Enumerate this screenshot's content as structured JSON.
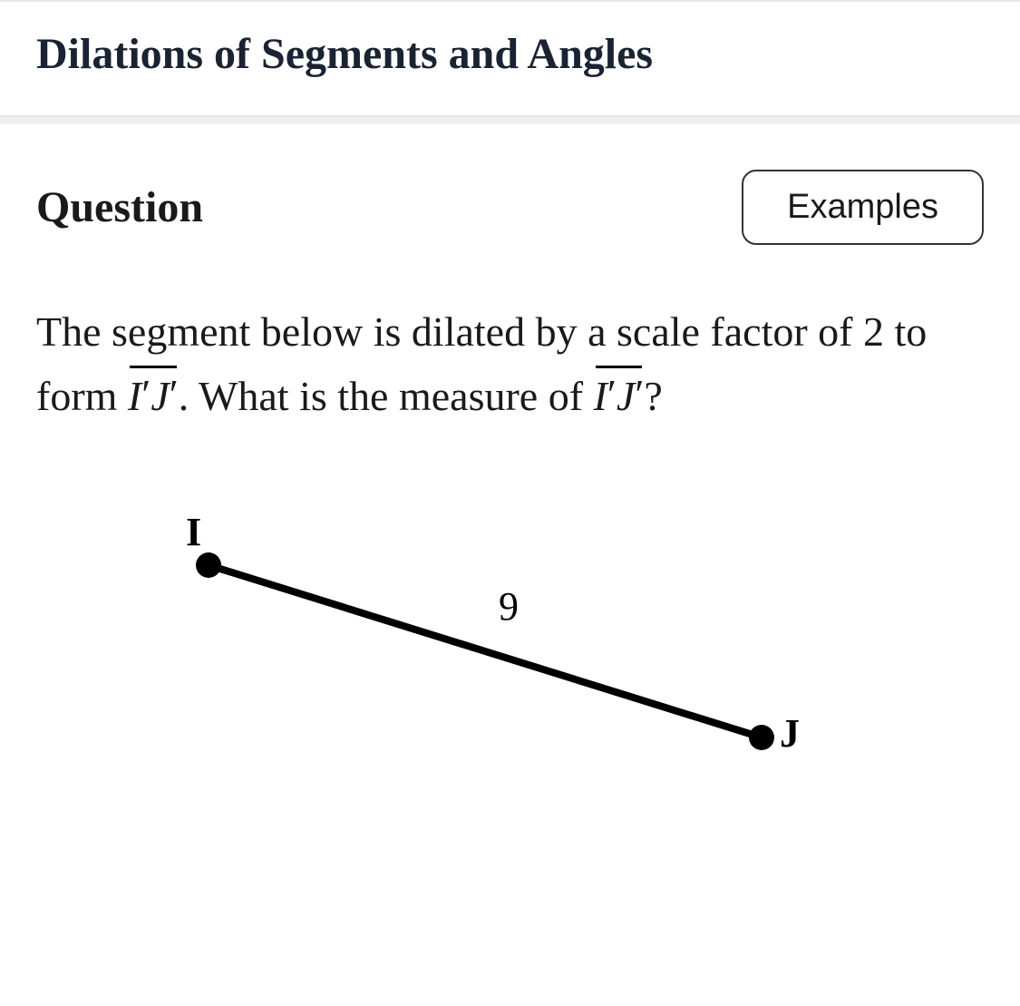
{
  "header": {
    "title": "Dilations of Segments and Angles"
  },
  "question": {
    "label": "Question",
    "examples_button": "Examples",
    "text_parts": {
      "p1": "The segment below is dilated by a scale factor of ",
      "scale_factor": "2",
      "p2": " to form ",
      "segment1_I": "I",
      "segment1_J": "J",
      "p3": ". What is the measure of ",
      "segment2_I": "I",
      "segment2_J": "J",
      "p4": "?"
    }
  },
  "diagram": {
    "point_I_label": "I",
    "point_J_label": "J",
    "segment_length": "9"
  }
}
